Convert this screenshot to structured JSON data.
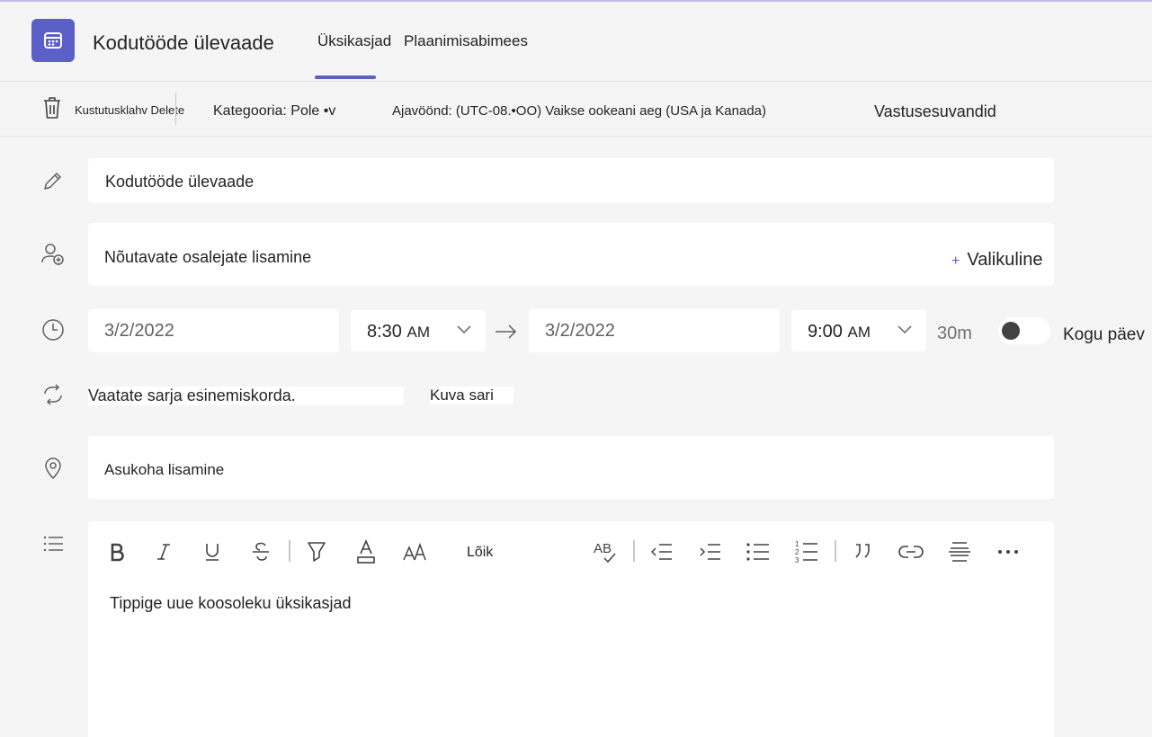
{
  "header": {
    "title": "Kodutööde ülevaade",
    "tabs": [
      {
        "label": "Üksikasjad",
        "active": true
      },
      {
        "label": "Plaanimisabimees",
        "active": false
      }
    ]
  },
  "toolbar": {
    "delete_label": "Kustutusklahv Delete",
    "category_label": "Kategooria: Pole •v",
    "timezone_label": "Ajavöönd: (UTC-08.•OO) Vaikse ookeani aeg (USA ja Kanada)",
    "response_label": "Vastusesuvandid"
  },
  "form": {
    "title_value": "Kodutööde ülevaade",
    "attendees_placeholder": "Nõutavate osalejate lisamine",
    "optional_label": "Valikuline",
    "start_date": "3/2/2022",
    "start_time": "8:30",
    "start_ampm": "AM",
    "end_date": "3/2/2022",
    "end_time": "9:00",
    "end_ampm": "AM",
    "duration": "30m",
    "all_day_label": "Kogu päev",
    "all_day_on": false,
    "recurrence_text": "Vaatate sarja esinemiskorda.",
    "view_series_link": "Kuva sari",
    "location_placeholder": "Asukoha lisamine"
  },
  "editor": {
    "paragraph_label": "Lõik",
    "spellcheck_label": "AB",
    "numbered_digits": [
      "1",
      "2",
      "3"
    ],
    "placeholder": "Tippige uue koosoleku üksikasjad"
  },
  "colors": {
    "accent": "#5b5fc7",
    "background": "#f5f5f5",
    "field": "#ffffff"
  }
}
